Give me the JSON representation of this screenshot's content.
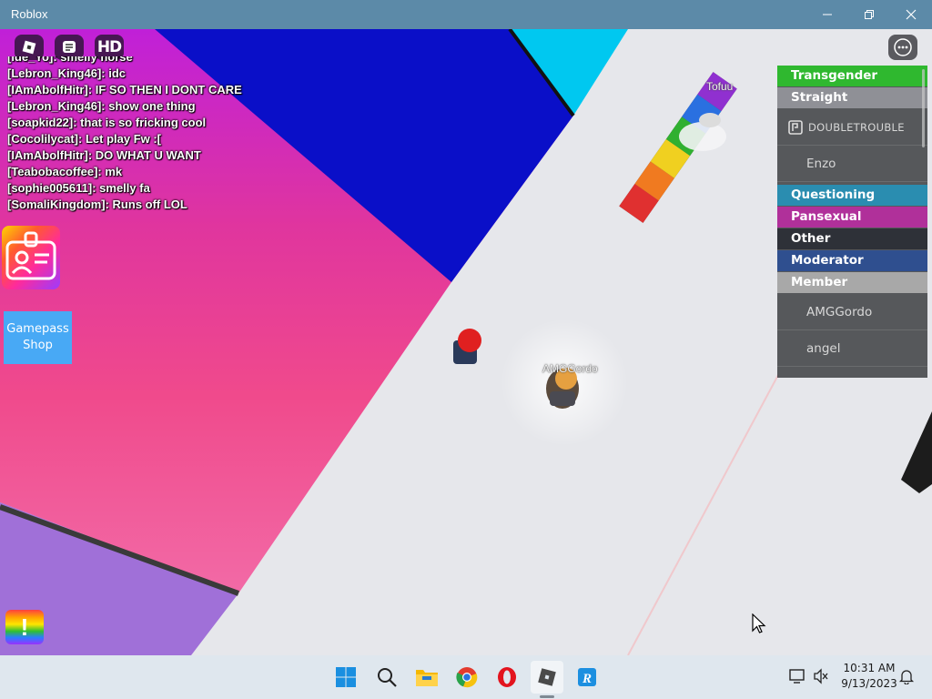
{
  "window": {
    "title": "Roblox"
  },
  "hud": {
    "hd_label": "HD"
  },
  "chat": {
    "messages": [
      "[ide_Yo]: smelly horse",
      "[Lebron_King46]: idc",
      "[IAmAbolfHitr]:  IF SO THEN I DONT CARE",
      "[Lebron_King46]: show one thing",
      "[soapkid22]: that is so fricking cool",
      "[Cocolilycat]:  Let play Fw :[",
      "[IAmAbolfHitr]:  DO WHAT U WANT",
      "[Teabobacoffee]:  mk",
      "[sophie005611]: smelly fa",
      "[SomaliKingdom]: Runs off LOL"
    ]
  },
  "left_panel": {
    "gamepass_label_1": "Gamepass",
    "gamepass_label_2": "Shop",
    "report_label": "!"
  },
  "nametags": {
    "player": "AMGGordo",
    "other": "Tofuu"
  },
  "leaderboard": {
    "teams": [
      {
        "name": "Transgender",
        "color": "#2fb82f"
      },
      {
        "name": "Straight",
        "color": "#8f9096"
      },
      {
        "name": "Questioning",
        "color": "#2a8db0"
      },
      {
        "name": "Pansexual",
        "color": "#b0309a"
      },
      {
        "name": "Other",
        "color": "#2e3138"
      },
      {
        "name": "Moderator",
        "color": "#2f4f8f"
      },
      {
        "name": "Member",
        "color": "#a8a8a8"
      }
    ],
    "players": {
      "straight_1": "DOUBLETROUBLE",
      "straight_2": "Enzo",
      "member_1": "AMGGordo",
      "member_2": "angel"
    }
  },
  "taskbar": {
    "apps": [
      "start-icon",
      "search-icon",
      "file-explorer-icon",
      "chrome-icon",
      "opera-icon",
      "roblox-icon",
      "roblox-studio-icon"
    ],
    "time": "10:31 AM",
    "date": "9/13/2023"
  },
  "colors": {
    "titlebar": "#5c8aa8",
    "taskbar": "#dfe7ee",
    "blue_wall": "#0a0fc8",
    "magenta": "#c825c8",
    "pink": "#f0468c"
  }
}
